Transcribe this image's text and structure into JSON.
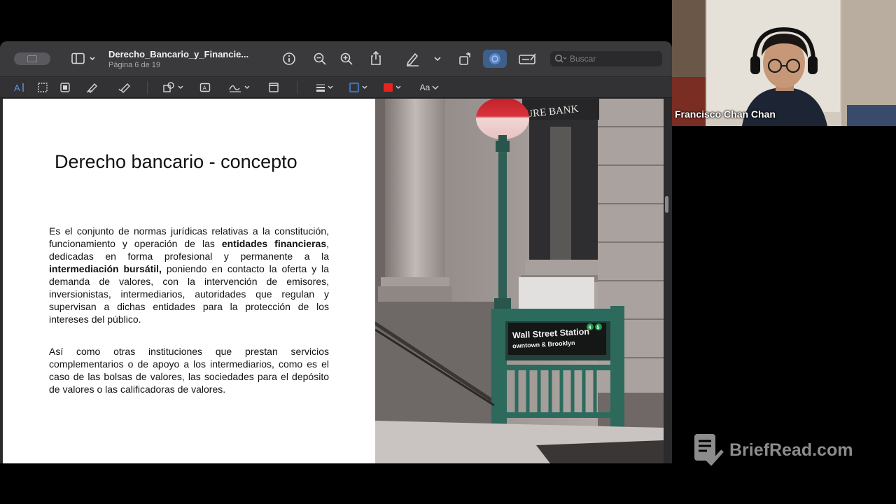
{
  "window": {
    "doc_title": "Derecho_Bancario_y_Financie...",
    "page_info": "Página 6 de 19",
    "search_placeholder": "Buscar"
  },
  "toolbar_icons": [
    "sidebar-icon",
    "info-icon",
    "zoom-out-icon",
    "zoom-in-icon",
    "share-icon",
    "markup-pen-icon",
    "rotate-icon",
    "markup-toggle-icon",
    "signature-box-icon",
    "search-icon"
  ],
  "format_icons": [
    "text-selection-icon",
    "rect-selection-icon",
    "sketch-icon",
    "draw-icon",
    "highlight-icon",
    "shapes-icon",
    "textbox-icon",
    "sign-icon",
    "note-icon",
    "line-style-icon",
    "border-color-icon",
    "fill-color-icon",
    "font-icon"
  ],
  "format_labels": {
    "font": "Aa"
  },
  "colors": {
    "accent_blue": "#3e5f8a",
    "fill_red": "#e8231f",
    "border_blue": "#3f6fb5"
  },
  "slide": {
    "title": "Derecho bancario - concepto",
    "p1": {
      "t1": "Es el conjunto de normas jurídicas relativas a la constitución, funcionamiento y operación de las ",
      "b1": "entidades financieras",
      "t2": ", dedicadas en forma profesional y permanente a la ",
      "b2": "intermediación bursátil,",
      "t3": " poniendo en contacto la oferta y la demanda de valores, con la intervención de emisores, inversionistas, intermediarios, autoridades que regulan y supervisan a dichas entidades para la protección de los intereses del público."
    },
    "p2": "Así como otras instituciones que prestan servicios complementarios o de apoyo a los intermediarios, como es el caso de las bolsas de valores, las sociedades para el depósito de valores o las calificadoras de valores.",
    "photo": {
      "bank_sign": "URE BANK",
      "station_sign": "Wall Street Station",
      "station_sub": "owntown & Brooklyn",
      "lines": [
        "4",
        "5"
      ]
    }
  },
  "video": {
    "participant": "Francisco Chan Chan"
  },
  "watermark": {
    "text": "BriefRead.com"
  }
}
